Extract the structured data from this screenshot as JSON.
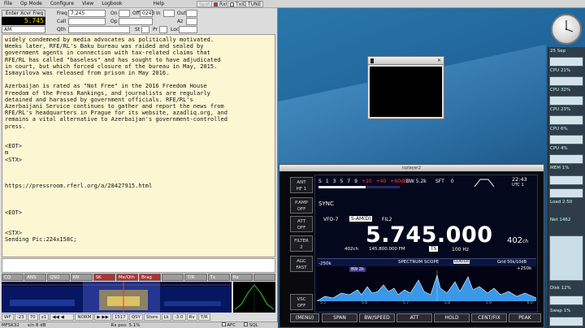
{
  "app": {
    "menu": [
      "File",
      "Op Mode",
      "Configure",
      "View",
      "Logbook",
      "Help"
    ],
    "spot_label": "Spot",
    "rxid_label": "RxID",
    "txid_label": "TxID",
    "tune_label": "TUNE"
  },
  "qso": {
    "xcvr_freq_btn": "Enter Xcvr Freq",
    "freq_label": "Freq",
    "freq_value": "7.245",
    "on_label": "On",
    "off_label": "Off",
    "off_value": "0243",
    "in_label": "In",
    "out_label": "Out",
    "call_label": "Call",
    "op_label": "Op",
    "az_label": "Az",
    "qth_label": "Qth",
    "st_label": "St",
    "pr_label": "Pr",
    "loc_label": "Loc",
    "display_freq": "5.745",
    "mode": "AM"
  },
  "rx_text": "widely condemned by media advocates as politically motivated.\nWeeks later, RFE/RL's Baku bureau was raided and sealed by\ngovernment agents in connection with tax-related claims that\nRFE/RL has called \"baseless\" and has sought to have adjudicated\nin court, but which forced closure of the bureau in May, 2015.\nIsmayilova was released from prison in May 2016.\n\nAzerbaijan is rated as \"Not Free\" in the 2016 Freedom House\nFreedom of the Press Rankings, and journalists are regularly\ndetained and harassed by government officials. RFE/RL's\nAzerbaijani Service continues to gather and report the news from\nRFE/RL's headquarters in Prague for its website, azadliq.org, and\nremains a vital alternative to Azerbaijan's government-controlled\npress.\n\n\n<EOT>\nm\n<STX>\n\n\n\nhttps://pressroom.rferl.org/a/28427915.html\n\n\n\n<EOT>\n\n\n<STX>\nSending Pic:224x158C;",
  "macros": [
    "CQ",
    "ANS",
    "QSO",
    "KN",
    "SK",
    "Me/Qth",
    "Brag",
    "",
    "T/R",
    "Tx",
    "Rx",
    ""
  ],
  "controls": {
    "wf": "WF",
    "v1": "-23",
    "v2": "70",
    "x1": "x1",
    "norm": "NORM",
    "cursor": "1517",
    "qsy": "QSY",
    "store": "Store",
    "lk": "Lk",
    "v3": "-3.0",
    "rv": "Rv",
    "tr": "T/R"
  },
  "status": {
    "mode": "MFSK32",
    "sn": "s/n  8 dB",
    "rx_pos": "Rx pos: 5.1%",
    "afc": "AFC",
    "sql": "SQL"
  },
  "radio": {
    "window_title": "icplayer2",
    "ant": "ANT",
    "hf": "HF 1",
    "pamp": "P.AMP",
    "pamp_state": "OFF",
    "att": "ATT",
    "att_state": "OFF",
    "filter": "FILTER",
    "filter_n": "2",
    "agc": "AGC",
    "agc_state": "FAST",
    "vsc": "VSC",
    "vsc_state": "OFF",
    "sync": "SYNC",
    "bw_label": "BW",
    "bw_value": "5.2k",
    "sft_label": "SFT",
    "sft_value": "0",
    "time": "22:43",
    "utc": "UTC",
    "utc_value": "1",
    "vfo": "VFO-7",
    "mode": "S-AM(D)",
    "fil": "FIL2",
    "frequency": "5.745.000",
    "channel": "402",
    "channel_unit": "ch",
    "ch_small": "402ch",
    "ch_freq": "145.800.000 FM",
    "ts": "TS",
    "ts_value": "100 Hz",
    "scope_title": "SPECTRUM SCOPE",
    "scope_center": "CENTER",
    "grid": "Grid",
    "grid_value": "50k/10dB",
    "span_left": "-250k",
    "span_right": "+250k",
    "bw_marker": "BW 2k",
    "scale_labels": [
      "5.5",
      "5.6",
      "5.7",
      "5.8",
      "5.9",
      "6.0"
    ],
    "s_scale": [
      "S",
      "1",
      "3",
      "5",
      "7",
      "9",
      "+20",
      "+40",
      "+60dB"
    ],
    "fkeys": [
      "(MENU)",
      "SPAN",
      "BW/SPEED",
      "ATT",
      "HOLD",
      "CENT/FIX",
      "PEAK"
    ]
  },
  "sidebar": {
    "date": "25 Sep",
    "items": [
      {
        "label": "CPU",
        "value": "21%"
      },
      {
        "label": "CPU",
        "value": "32%"
      },
      {
        "label": "CPU",
        "value": "23%"
      },
      {
        "label": "CPU",
        "value": "6%"
      },
      {
        "label": "CPU",
        "value": "4%"
      },
      {
        "label": "MEM",
        "value": "1%"
      },
      {
        "label": "Load",
        "value": "2.50"
      },
      {
        "label": "Net",
        "value": "1462"
      },
      {
        "label": "Disk",
        "value": "12%"
      },
      {
        "label": "Swap",
        "value": "1%"
      }
    ]
  }
}
